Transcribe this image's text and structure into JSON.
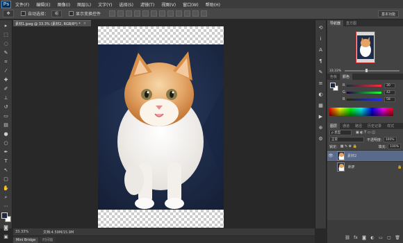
{
  "app": {
    "logo_text": "Ps"
  },
  "menu": [
    "文件(F)",
    "编辑(E)",
    "图像(I)",
    "图层(L)",
    "文字(Y)",
    "选择(S)",
    "滤镜(T)",
    "视图(V)",
    "窗口(W)",
    "帮助(H)"
  ],
  "options": {
    "auto_select_label": "自动选择：",
    "auto_select_value": "组",
    "show_transform_label": "显示变换控件",
    "workspace": "基本功能"
  },
  "document": {
    "tab_title": "素材1.jpeg @ 33.3% (素材2, RGB/8*) *",
    "tab_close": "×",
    "zoom": "33.33%",
    "doc_info": "文档:4.59M/15.9M"
  },
  "bottom_tabs": [
    "Mini Bridge",
    "时间轴"
  ],
  "panels": {
    "navigator_tabs": [
      "导航器",
      "直方图"
    ],
    "navigator_zoom": "33.33%",
    "color_tabs": [
      "色板",
      "颜色"
    ],
    "color": {
      "fg": "#1b2a40",
      "bg": "#ffffff",
      "rows": [
        {
          "label": "R",
          "value": "30"
        },
        {
          "label": "G",
          "value": "42"
        },
        {
          "label": "B",
          "value": "58"
        }
      ]
    },
    "layers_tabs": [
      "图层",
      "通道",
      "路径",
      "历史记录",
      "样式"
    ],
    "kind": "ρ 类型",
    "blend_mode": "正常",
    "opacity_label": "不透明度:",
    "opacity": "100%",
    "lock_label": "锁定:",
    "fill_label": "填充:",
    "fill": "100%",
    "layers": [
      {
        "name": "素材2",
        "selected": true
      },
      {
        "name": "背景",
        "selected": false
      }
    ]
  }
}
